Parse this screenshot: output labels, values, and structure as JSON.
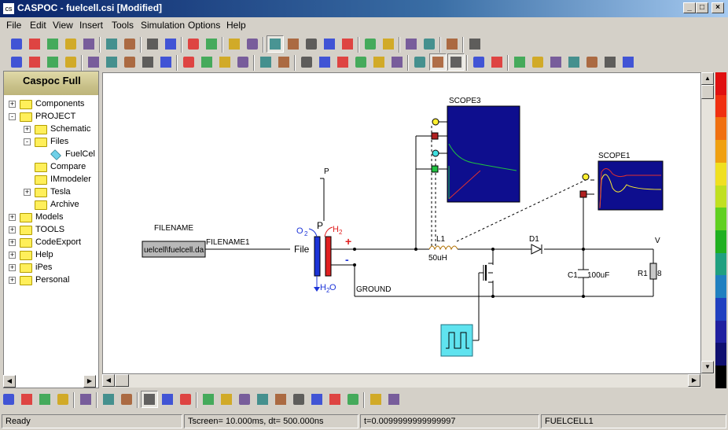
{
  "window": {
    "title": "CASPOC - fuelcell.csi [Modified]"
  },
  "menu": [
    "File",
    "Edit",
    "View",
    "Insert",
    "Tools",
    "Simulation",
    "Options",
    "Help"
  ],
  "sidebar": {
    "header": "Caspoc Full",
    "items": [
      {
        "label": "Components",
        "level": 0,
        "expander": "+"
      },
      {
        "label": "PROJECT",
        "level": 0,
        "expander": "-"
      },
      {
        "label": "Schematic",
        "level": 1,
        "expander": "+"
      },
      {
        "label": "Files",
        "level": 1,
        "expander": "-"
      },
      {
        "label": "FuelCel",
        "level": 2,
        "expander": ""
      },
      {
        "label": "Compare",
        "level": 1,
        "expander": ""
      },
      {
        "label": "IMmodeler",
        "level": 1,
        "expander": ""
      },
      {
        "label": "Tesla",
        "level": 1,
        "expander": "+"
      },
      {
        "label": "Archive",
        "level": 1,
        "expander": ""
      },
      {
        "label": "Models",
        "level": 0,
        "expander": "+"
      },
      {
        "label": "TOOLS",
        "level": 0,
        "expander": "+"
      },
      {
        "label": "CodeExport",
        "level": 0,
        "expander": "+"
      },
      {
        "label": "Help",
        "level": 0,
        "expander": "+"
      },
      {
        "label": "iPes",
        "level": 0,
        "expander": "+"
      },
      {
        "label": "Personal",
        "level": 0,
        "expander": "+"
      }
    ]
  },
  "schematic": {
    "filename_title": "FILENAME",
    "filename_value": "uelcell\\fuelcell.da",
    "filename_net": "FILENAME1",
    "file_label": "File",
    "p_label_top": "P",
    "p_label": "P",
    "o2_label": "O",
    "o2_sub": "2",
    "h2_label": "H",
    "h2_sub": "2",
    "h2o_label": "H",
    "h2o_sub1": "2",
    "h2o_sub2": "O",
    "plus": "+",
    "minus": "-",
    "ground": "GROUND",
    "l1": "L1",
    "l1_value": "50uH",
    "d1": "D1",
    "c1": "C1",
    "c1_value": "100uF",
    "r1": "R1",
    "r1_value": "8",
    "v_label": "V",
    "scope3": "SCOPE3",
    "scope1": "SCOPE1"
  },
  "statusbar": {
    "ready": "Ready",
    "tscreen": "Tscreen= 10.000ms, dt= 500.000ns",
    "time": "t=0.0099999999999997",
    "file": "FUELCELL1"
  },
  "colors": {
    "scope_bg": "#0e0e8e",
    "inductor": "#b07000",
    "fuel_blue": "#1c34d8",
    "fuel_red": "#e02020"
  },
  "icons": {
    "toolbar1": [
      "new-icon",
      "open-icon",
      "save-icon",
      "print-icon",
      "cut-icon",
      "copy-icon",
      "paste-icon",
      "undo-icon",
      "redo-icon",
      "run-icon",
      "pause-icon",
      "curve-icon",
      "waveform-icon",
      "hand-icon",
      "edit-icon",
      "list-icon",
      "align-icon",
      "settings-icon",
      "connect-icon",
      "disconnect-icon",
      "export-icon",
      "import-icon",
      "arrow-icon",
      "help-icon"
    ],
    "toolbar2": [
      "zoom100-icon",
      "fit-icon",
      "zoom-width-icon",
      "zoom-height-icon",
      "ground-icon",
      "flip-icon",
      "mirror-left-icon",
      "mirror-right-icon",
      "filter-icon",
      "globe-icon",
      "globe2-icon",
      "globe3-icon",
      "probe-icon",
      "text-icon",
      "node-icon",
      "cross-icon",
      "wire-icon",
      "wire2-icon",
      "block-icon",
      "label123-icon",
      "spark-icon",
      "pointer-icon",
      "grid-icon",
      "clock-icon",
      "fill-icon",
      "bars-icon",
      "scope-icon",
      "scope2-icon",
      "truck-icon",
      "sort-icon",
      "chip-icon",
      "chip2-icon",
      "table-icon"
    ],
    "bottom": [
      "chart-icon",
      "document-icon",
      "grid-icon",
      "chip-icon",
      "g-icon",
      "tree-icon",
      "tree2-icon",
      "image-icon",
      "image2-icon",
      "pen-icon",
      "record-icon",
      "first-icon",
      "fast-back-icon",
      "back-icon",
      "step-back-icon",
      "play-icon",
      "step-icon",
      "fast-forward-icon",
      "last-icon",
      "window-icon",
      "windows-icon"
    ]
  }
}
